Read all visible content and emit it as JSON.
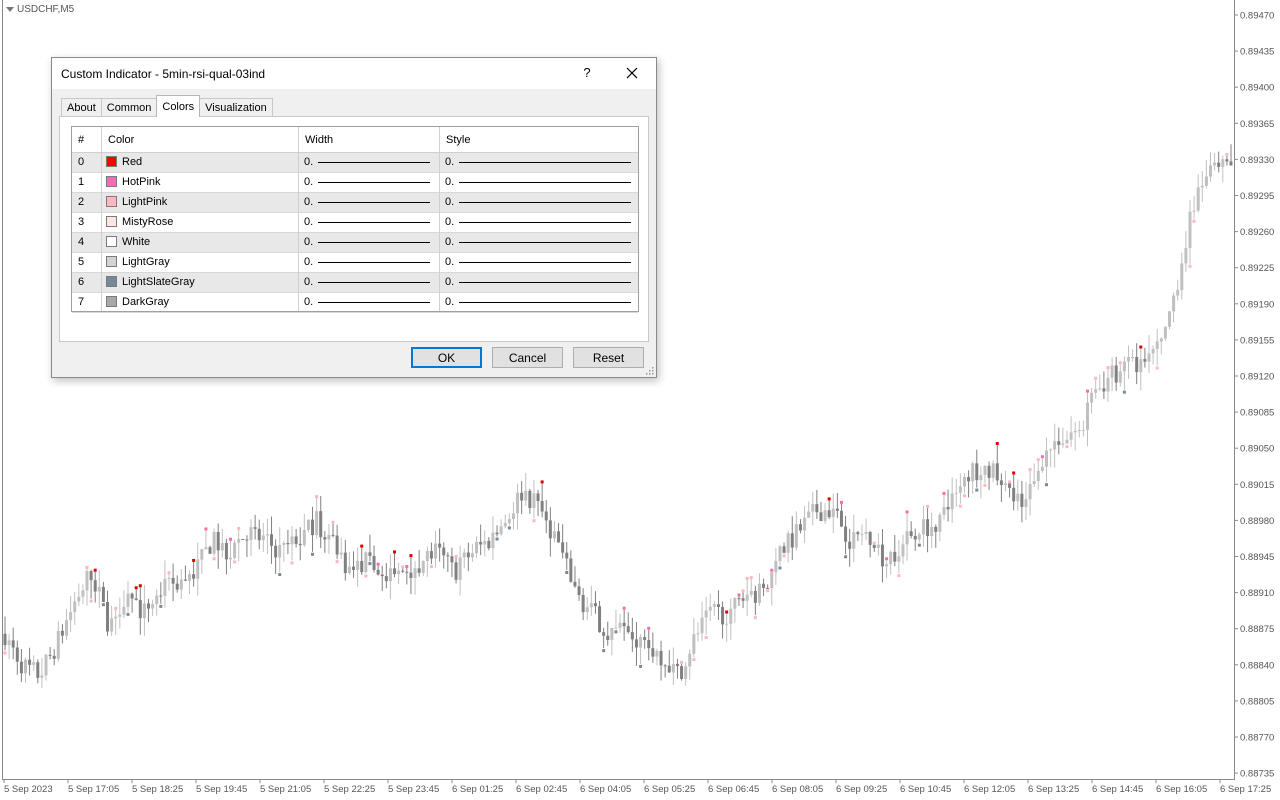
{
  "chart": {
    "symbol": "USDCHF,M5",
    "price_labels": [
      "0.89470",
      "0.89435",
      "0.89400",
      "0.89365",
      "0.89330",
      "0.89295",
      "0.89260",
      "0.89225",
      "0.89190",
      "0.89155",
      "0.89120",
      "0.89085",
      "0.89050",
      "0.89015",
      "0.88980",
      "0.88945",
      "0.88910",
      "0.88875",
      "0.88840",
      "0.88805",
      "0.88770",
      "0.88735"
    ],
    "time_labels": [
      "5 Sep 2023",
      "5 Sep 17:05",
      "5 Sep 18:25",
      "5 Sep 19:45",
      "5 Sep 21:05",
      "5 Sep 22:25",
      "5 Sep 23:45",
      "6 Sep 01:25",
      "6 Sep 02:45",
      "6 Sep 04:05",
      "6 Sep 05:25",
      "6 Sep 06:45",
      "6 Sep 08:05",
      "6 Sep 09:25",
      "6 Sep 10:45",
      "6 Sep 12:05",
      "6 Sep 13:25",
      "6 Sep 14:45",
      "6 Sep 16:05",
      "6 Sep 17:25"
    ],
    "price_path": [
      0.8887,
      0.8884,
      0.8883,
      0.8886,
      0.889,
      0.8893,
      0.8888,
      0.8891,
      0.8889,
      0.8891,
      0.8892,
      0.8893,
      0.8896,
      0.8895,
      0.8897,
      0.8896,
      0.8895,
      0.8896,
      0.8898,
      0.8896,
      0.8893,
      0.8894,
      0.8892,
      0.8893,
      0.8894,
      0.8895,
      0.8893,
      0.8895,
      0.8896,
      0.8898,
      0.8901,
      0.8899,
      0.8896,
      0.8891,
      0.8889,
      0.8887,
      0.8887,
      0.8886,
      0.8885,
      0.8883,
      0.8887,
      0.8889,
      0.8889,
      0.8891,
      0.8891,
      0.8895,
      0.8897,
      0.8899,
      0.8899,
      0.8896,
      0.8897,
      0.8894,
      0.8896,
      0.8897,
      0.8898,
      0.89,
      0.8903,
      0.8903,
      0.8901,
      0.8899,
      0.8904,
      0.8906,
      0.8906,
      0.891,
      0.8912,
      0.8913,
      0.8913,
      0.8915,
      0.8922,
      0.893,
      0.8932,
      0.8932
    ],
    "colors": {
      "grid_axis": "#888888",
      "candle_up": "#c0c0c0",
      "candle_down": "#808080",
      "marker_red": "#e00000",
      "marker_pink": "#ff69b4",
      "marker_lightpink": "#ffb6c1",
      "marker_slate": "#778899"
    }
  },
  "dialog": {
    "title": "Custom Indicator - 5min-rsi-qual-03ind",
    "help": "?",
    "tabs": [
      {
        "label": "About",
        "active": false
      },
      {
        "label": "Common",
        "active": false
      },
      {
        "label": "Colors",
        "active": true
      },
      {
        "label": "Visualization",
        "active": false
      }
    ],
    "columns": {
      "index": "#",
      "color": "Color",
      "width": "Width",
      "style": "Style"
    },
    "rows": [
      {
        "index": "0",
        "name": "Red",
        "hex": "#ff0000",
        "width": "0.",
        "style": "0."
      },
      {
        "index": "1",
        "name": "HotPink",
        "hex": "#ff69b4",
        "width": "0.",
        "style": "0."
      },
      {
        "index": "2",
        "name": "LightPink",
        "hex": "#ffb6c1",
        "width": "0.",
        "style": "0."
      },
      {
        "index": "3",
        "name": "MistyRose",
        "hex": "#ffe4e1",
        "width": "0.",
        "style": "0."
      },
      {
        "index": "4",
        "name": "White",
        "hex": "#ffffff",
        "width": "0.",
        "style": "0."
      },
      {
        "index": "5",
        "name": "LightGray",
        "hex": "#d3d3d3",
        "width": "0.",
        "style": "0."
      },
      {
        "index": "6",
        "name": "LightSlateGray",
        "hex": "#778899",
        "width": "0.",
        "style": "0."
      },
      {
        "index": "7",
        "name": "DarkGray",
        "hex": "#a9a9a9",
        "width": "0.",
        "style": "0."
      }
    ],
    "buttons": {
      "ok": "OK",
      "cancel": "Cancel",
      "reset": "Reset"
    }
  }
}
